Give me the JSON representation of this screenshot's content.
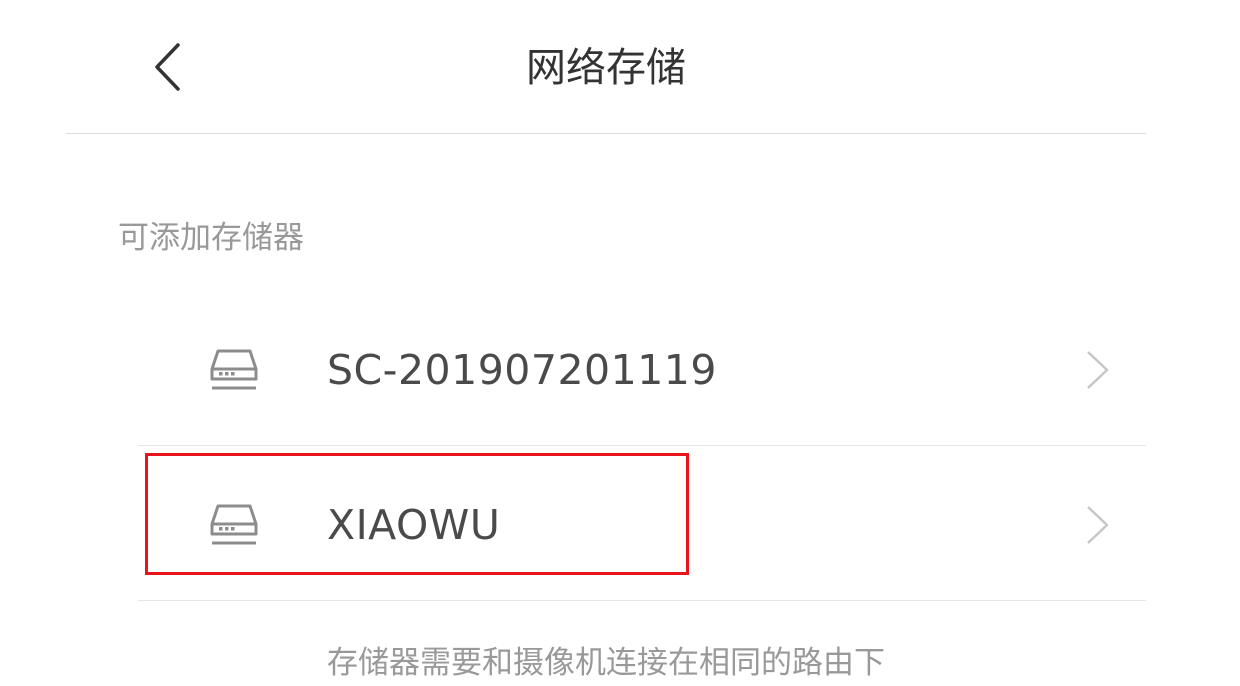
{
  "header": {
    "title": "网络存储",
    "back_icon": "chevron-left-icon"
  },
  "section": {
    "title": "可添加存储器"
  },
  "devices": [
    {
      "name": "SC-201907201119",
      "icon": "storage-drive-icon",
      "chevron": "chevron-right-icon"
    },
    {
      "name": "XIAOWU",
      "icon": "storage-drive-icon",
      "chevron": "chevron-right-icon",
      "highlighted": true
    }
  ],
  "footer": {
    "note": "存储器需要和摄像机连接在相同的路由下"
  },
  "colors": {
    "title_text": "#333333",
    "secondary_text": "#999999",
    "device_text": "#4a4a4a",
    "divider": "#dcdcdc",
    "icon": "#8c8c8c",
    "chevron": "#c7c7c7",
    "highlight_border": "#e8141b"
  }
}
